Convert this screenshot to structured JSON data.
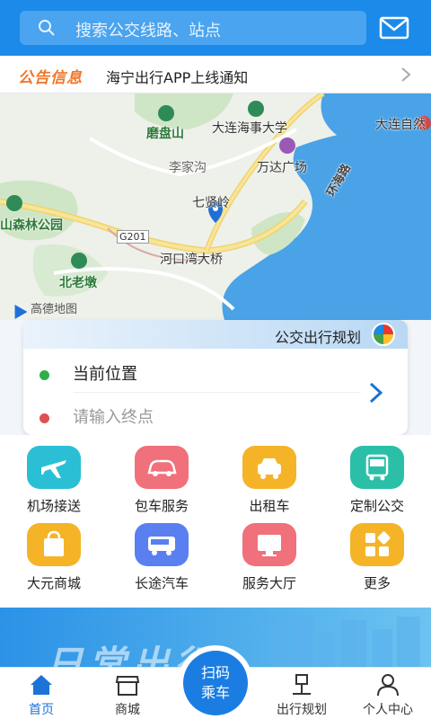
{
  "header": {
    "search_placeholder": "搜索公交线路、站点",
    "search_icon": "search-icon",
    "mail_icon": "mail-icon"
  },
  "notice": {
    "tag": "公告信息",
    "message": "海宁出行APP上线通知"
  },
  "map": {
    "labels": {
      "mopan": "磨盘山",
      "dmu": "大连海事大学",
      "dalian_nature": "大连自然",
      "lijiagou": "李家沟",
      "wanda": "万达广场",
      "qixianling": "七贤岭",
      "forest_park": "山森林公园",
      "g201": "G201",
      "hekou": "河口湾大桥",
      "beilaodun": "北老墩",
      "huanhai": "环海路"
    },
    "provider": "高德地图"
  },
  "planner": {
    "title": "公交出行规划",
    "current_location": "当前位置",
    "destination_placeholder": "请输入终点"
  },
  "services": [
    {
      "label": "机场接送",
      "color": "#2bbfd6",
      "icon": "airport-shuttle-icon"
    },
    {
      "label": "包车服务",
      "color": "#f0707c",
      "icon": "charter-car-icon"
    },
    {
      "label": "出租车",
      "color": "#f5b428",
      "icon": "taxi-icon"
    },
    {
      "label": "定制公交",
      "color": "#2bbfa8",
      "icon": "custom-bus-icon"
    },
    {
      "label": "大元商城",
      "color": "#f5b428",
      "icon": "shopping-bag-icon"
    },
    {
      "label": "长途汽车",
      "color": "#5a7ff0",
      "icon": "coach-bus-icon"
    },
    {
      "label": "服务大厅",
      "color": "#f0707c",
      "icon": "service-hall-icon"
    },
    {
      "label": "更多",
      "color": "#f5b428",
      "icon": "more-grid-icon"
    }
  ],
  "banner": {
    "text": "日常出行"
  },
  "nav": {
    "home": "首页",
    "mall": "商城",
    "scan_line1": "扫码",
    "scan_line2": "乘车",
    "trip_plan": "出行规划",
    "profile": "个人中心"
  },
  "colors": {
    "primary": "#1b8ae8",
    "notice_tag": "#f0772a",
    "green_dot": "#2fae4a",
    "red_dot": "#e05050"
  }
}
